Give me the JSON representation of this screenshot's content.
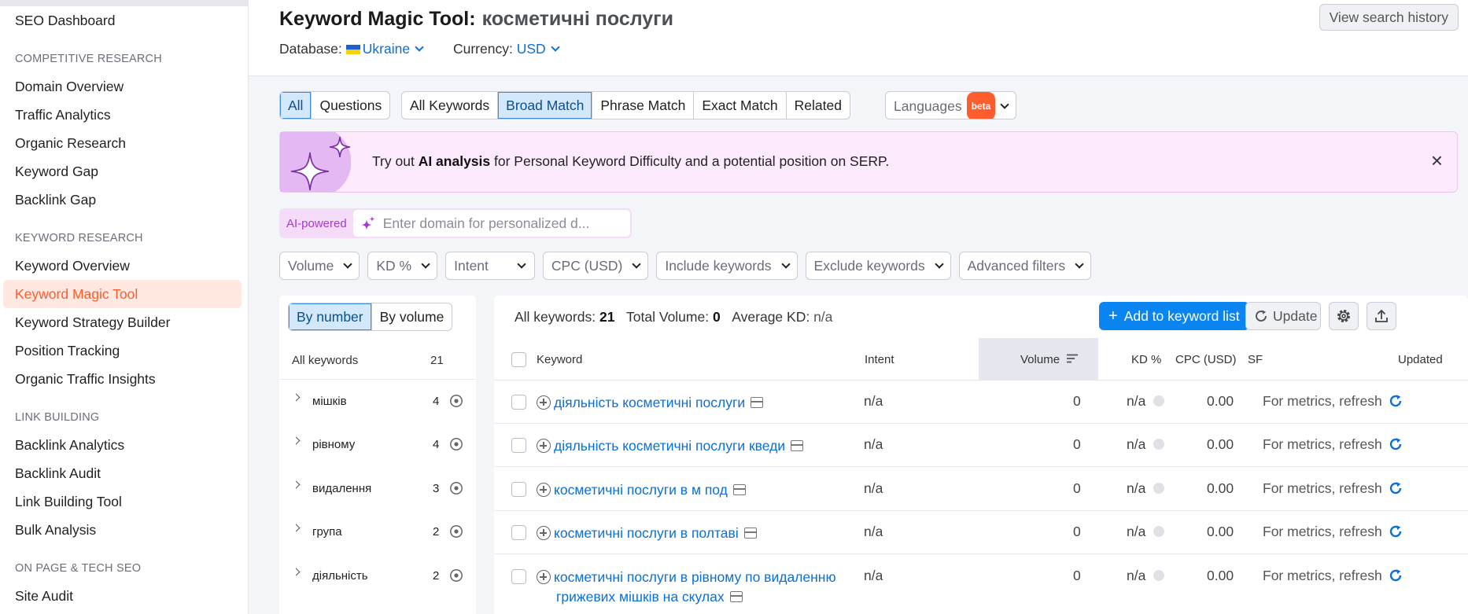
{
  "sidebar": {
    "top_items": [
      "SEO Dashboard"
    ],
    "sections": [
      {
        "title": "COMPETITIVE RESEARCH",
        "items": [
          "Domain Overview",
          "Traffic Analytics",
          "Organic Research",
          "Keyword Gap",
          "Backlink Gap"
        ]
      },
      {
        "title": "KEYWORD RESEARCH",
        "items": [
          "Keyword Overview",
          "Keyword Magic Tool",
          "Keyword Strategy Builder",
          "Position Tracking",
          "Organic Traffic Insights"
        ]
      },
      {
        "title": "LINK BUILDING",
        "items": [
          "Backlink Analytics",
          "Backlink Audit",
          "Link Building Tool",
          "Bulk Analysis"
        ]
      },
      {
        "title": "ON PAGE & TECH SEO",
        "items": [
          "Site Audit"
        ]
      }
    ],
    "active_item": "Keyword Magic Tool"
  },
  "header": {
    "title": "Keyword Magic Tool:",
    "query": "косметичні послуги",
    "database_label": "Database:",
    "database_value": "Ukraine",
    "currency_label": "Currency:",
    "currency_value": "USD",
    "history_button": "View search history"
  },
  "tabs": {
    "type_tabs": [
      "All",
      "Questions"
    ],
    "match_tabs": [
      "All Keywords",
      "Broad Match",
      "Phrase Match",
      "Exact Match",
      "Related"
    ],
    "languages": "Languages",
    "beta": "beta",
    "active_type": "All",
    "active_match": "Broad Match"
  },
  "banner": {
    "pre": "Try out",
    "bold": "AI analysis",
    "post": "for Personal Keyword Difficulty and a potential position on SERP.",
    "close": "×"
  },
  "ai": {
    "label": "AI-powered",
    "placeholder": "Enter domain for personalized d..."
  },
  "filters": [
    "Volume",
    "KD %",
    "Intent",
    "CPC (USD)",
    "Include keywords",
    "Exclude keywords",
    "Advanced filters"
  ],
  "groups": {
    "toggle": [
      "By number",
      "By volume"
    ],
    "header_label": "All keywords",
    "header_count": "21",
    "items": [
      {
        "name": "мішків",
        "count": "4"
      },
      {
        "name": "рівному",
        "count": "4"
      },
      {
        "name": "видалення",
        "count": "3"
      },
      {
        "name": "група",
        "count": "2"
      },
      {
        "name": "діяльність",
        "count": "2"
      }
    ]
  },
  "table": {
    "stats": {
      "all_label": "All keywords:",
      "all_value": "21",
      "vol_label": "Total Volume:",
      "vol_value": "0",
      "kd_label": "Average KD:",
      "kd_value": "n/a"
    },
    "add_button": "Add to keyword list",
    "update_button": "Update",
    "columns": [
      "Keyword",
      "Intent",
      "Volume",
      "KD %",
      "CPC (USD)",
      "SF",
      "Updated"
    ],
    "rows": [
      {
        "keyword": "діяльність косметичні послуги",
        "keyword2": "",
        "intent": "n/a",
        "volume": "0",
        "kd": "n/a",
        "cpc": "0.00",
        "updated": "For metrics, refresh"
      },
      {
        "keyword": "діяльність косметичні послуги кведи",
        "keyword2": "",
        "intent": "n/a",
        "volume": "0",
        "kd": "n/a",
        "cpc": "0.00",
        "updated": "For metrics, refresh"
      },
      {
        "keyword": "косметичні послуги в м под",
        "keyword2": "",
        "intent": "n/a",
        "volume": "0",
        "kd": "n/a",
        "cpc": "0.00",
        "updated": "For metrics, refresh"
      },
      {
        "keyword": "косметичні послуги в полтаві",
        "keyword2": "",
        "intent": "n/a",
        "volume": "0",
        "kd": "n/a",
        "cpc": "0.00",
        "updated": "For metrics, refresh"
      },
      {
        "keyword": "косметичні послуги в рівному по видаленню",
        "keyword2": "грижевих мішків на скулах",
        "intent": "n/a",
        "volume": "0",
        "kd": "n/a",
        "cpc": "0.00",
        "updated": "For metrics, refresh"
      }
    ]
  },
  "colors": {
    "accent": "#0a84f0",
    "brand": "#ff5c2e",
    "link": "#0a6fd6",
    "ai": "#a23bd1"
  }
}
